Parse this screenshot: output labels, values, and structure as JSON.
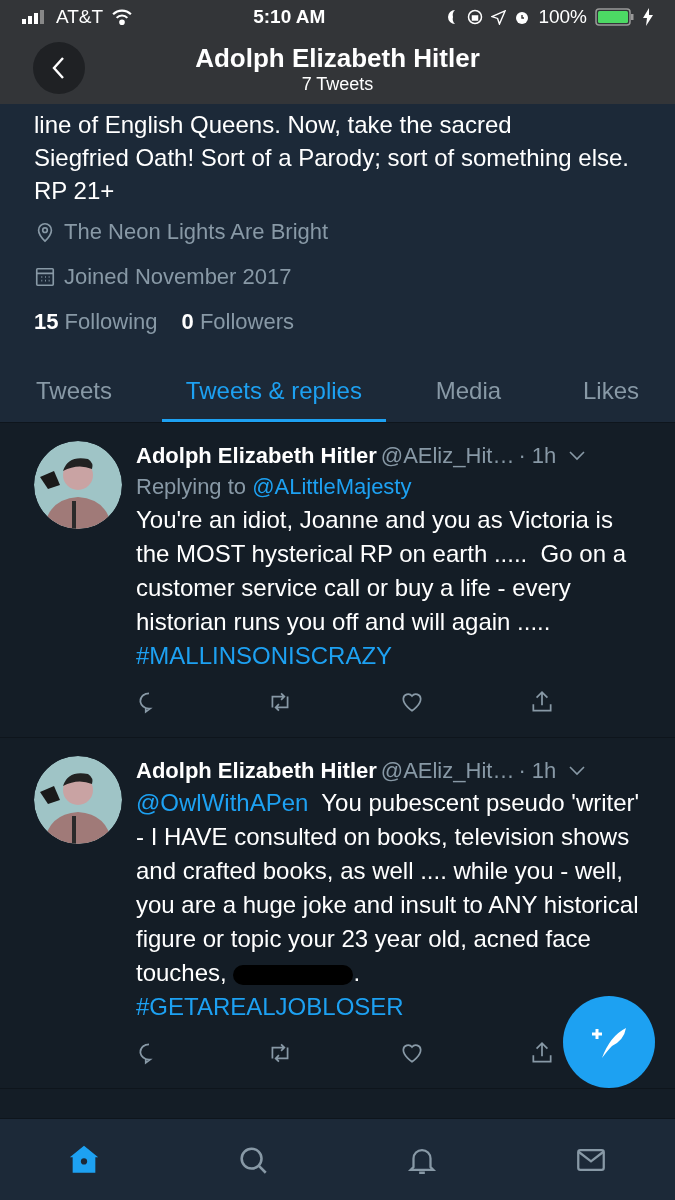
{
  "status_bar": {
    "carrier": "AT&T",
    "time": "5:10 AM",
    "battery": "100%"
  },
  "header": {
    "title": "Adolph Elizabeth Hitler",
    "subtitle": "7 Tweets"
  },
  "profile": {
    "bio_lines": [
      "line of English Queens. Now, take the sacred",
      "Siegfried Oath! Sort of a Parody; sort of something else. RP 21+"
    ],
    "location": "The Neon Lights Are Bright",
    "joined": "Joined November 2017",
    "stats": [
      {
        "count": "15",
        "label": "Following"
      },
      {
        "count": "0",
        "label": "Followers"
      }
    ]
  },
  "tabs": [
    {
      "label": "Tweets",
      "selected": false
    },
    {
      "label": "Tweets & replies",
      "selected": true
    },
    {
      "label": "Media",
      "selected": false
    },
    {
      "label": "Likes",
      "selected": false
    }
  ],
  "tweets": [
    {
      "name": "Adolph Elizabeth Hitler",
      "handle": "@AEliz_Hit…",
      "time": "· 1h",
      "replying_prefix": "Replying to",
      "replying_to": "@ALittleMajesty",
      "segments": [
        {
          "kind": "text",
          "text": "You're an idiot, Joanne and you as Victoria is the MOST hysterical RP on earth .....  Go on a customer service call or buy a life - every historian runs you off and will again .....  "
        },
        {
          "kind": "hashtag",
          "text": "#MALLINSONISCRAZY"
        }
      ]
    },
    {
      "name": "Adolph Elizabeth Hitler",
      "handle": "@AEliz_Hit…",
      "time": "· 1h",
      "segments": [
        {
          "kind": "mention",
          "text": "@OwlWithAPen"
        },
        {
          "kind": "text",
          "text": "  You pubescent pseudo 'writer' - I HAVE consulted on books, television shows and crafted books, as well .... while you - well, you are a huge joke and insult to ANY historical figure or topic your 23 year old, acned face touches, "
        },
        {
          "kind": "redaction"
        },
        {
          "kind": "text",
          "text": "."
        },
        {
          "kind": "break"
        },
        {
          "kind": "hashtag",
          "text": "#GETAREALJOBLOSER"
        }
      ]
    }
  ],
  "nav": [
    {
      "kind": "home",
      "selected": true
    },
    {
      "kind": "search",
      "selected": false
    },
    {
      "kind": "notifications",
      "selected": false
    },
    {
      "kind": "messages",
      "selected": false
    }
  ]
}
